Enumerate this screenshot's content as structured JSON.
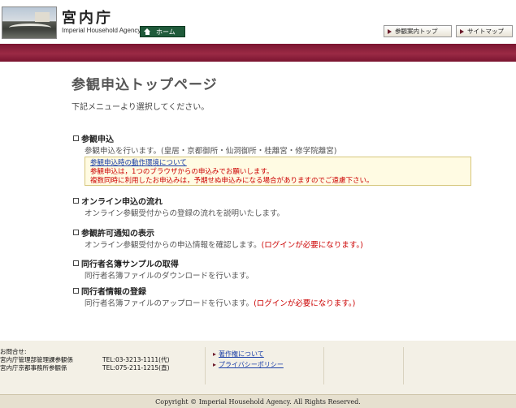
{
  "header": {
    "site_title": "宮内庁",
    "site_subtitle": "Imperial Household Agency",
    "home_label": "ホーム",
    "guide_label": "参観案内トップ",
    "sitemap_label": "サイトマップ"
  },
  "main": {
    "title": "参観申込トップページ",
    "lead": "下記メニューより選択してください。",
    "items": [
      {
        "title": "参観申込",
        "desc": "参観申込を行います。(皇居・京都御所・仙洞御所・桂離宮・修学院離宮)",
        "note": ""
      },
      {
        "title": "オンライン申込の流れ",
        "desc": "オンライン参観受付からの登録の流れを説明いたします。",
        "note": ""
      },
      {
        "title": "参観許可通知の表示",
        "desc": "オンライン参観受付からの申込情報を確認します。",
        "note": "(ログインが必要になります。)"
      },
      {
        "title": "同行者名簿サンプルの取得",
        "desc": "同行者名簿ファイルのダウンロードを行います。",
        "note": ""
      },
      {
        "title": "同行者情報の登録",
        "desc": "同行者名簿ファイルのアップロードを行います。",
        "note": "(ログインが必要になります。)"
      }
    ],
    "notice": {
      "link": "参観申込時の動作環境について",
      "line1": "参観申込は，1つのブラウザからの申込みでお願いします。",
      "line2": "複数同時に利用したお申込みは，予期せぬ申込みになる場合がありますのでご遠慮下さい。"
    }
  },
  "footer": {
    "contact_title": "お問合せ:",
    "contact_rows": [
      {
        "name": "宮内庁管理部管理課参観係",
        "tel": "TEL:03-3213-1111(代)"
      },
      {
        "name": "宮内庁京都事務所参観係",
        "tel": "TEL:075-211-1215(直)"
      }
    ],
    "links": [
      "著作権について",
      "プライバシーポリシー"
    ],
    "copyright": "Copyright © Imperial Household Agency. All Rights Reserved."
  },
  "colors": {
    "accent": "#7b1530",
    "home": "#1f5a3a",
    "link": "#1a3ea8",
    "warning": "#cc0000"
  }
}
